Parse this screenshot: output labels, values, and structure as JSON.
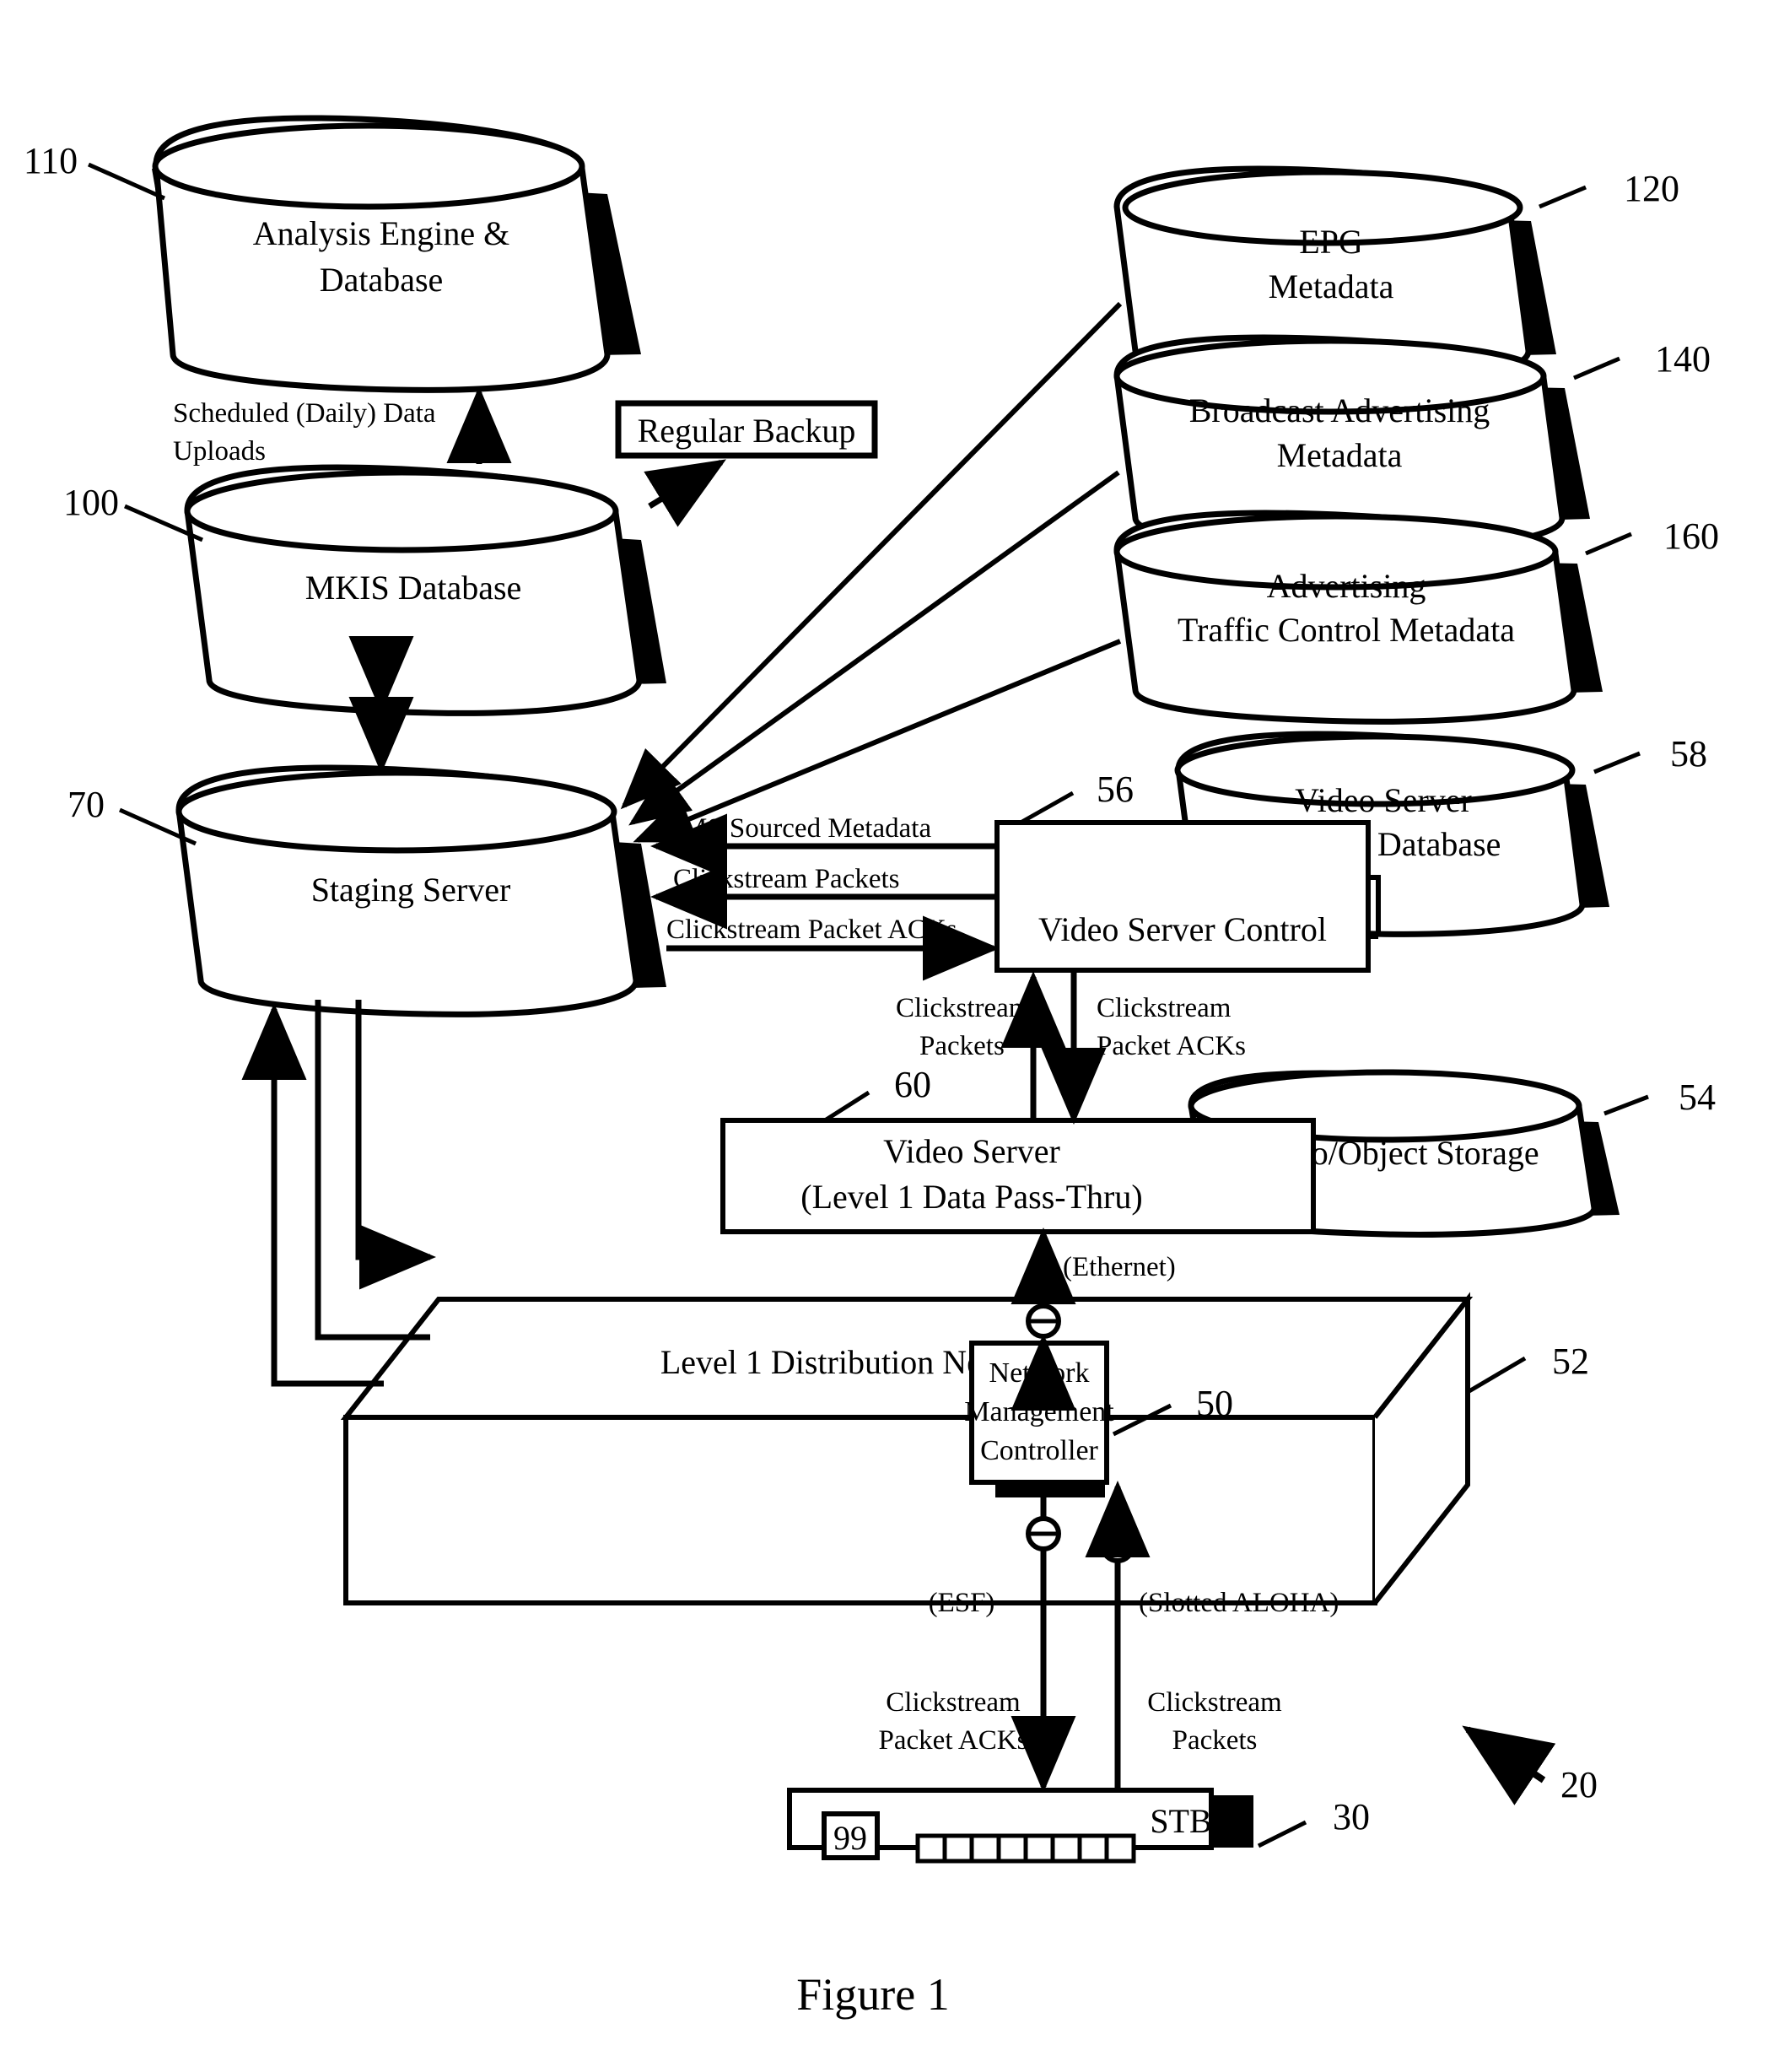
{
  "figure": {
    "caption": "Figure 1",
    "overall_ref": "20"
  },
  "nodes": {
    "analysis_engine": {
      "line1": "Analysis Engine &",
      "line2": "Database",
      "ref": "110",
      "shape": "cylinder"
    },
    "mkis_database": {
      "line1": "MKIS Database",
      "line2": "",
      "ref": "100",
      "shape": "cylinder"
    },
    "staging_server": {
      "line1": "Staging Server",
      "line2": "",
      "ref": "70",
      "shape": "cylinder"
    },
    "epg_metadata": {
      "line1": "EPG",
      "line2": "Metadata",
      "ref": "120",
      "shape": "cylinder"
    },
    "broadcast_ad_metadata": {
      "line1": "Broadcast Advertising",
      "line2": "Metadata",
      "ref": "140",
      "shape": "cylinder"
    },
    "ad_traffic_metadata": {
      "line1": "Advertising",
      "line2": "Traffic Control Metadata",
      "ref": "160",
      "shape": "cylinder"
    },
    "video_server_control_db": {
      "line1": "Video Server",
      "line2": "Control Database",
      "ref": "58",
      "shape": "cylinder"
    },
    "video_object_storage": {
      "line1": "Video/Object Storage",
      "line2": "",
      "ref": "54",
      "shape": "cylinder"
    },
    "regular_backup": {
      "line1": "Regular Backup",
      "line2": "",
      "ref": "",
      "shape": "box"
    },
    "video_server_control": {
      "line1": "Video Server Control",
      "line2": "",
      "ref": "56",
      "shape": "box"
    },
    "video_server": {
      "line1": "Video Server",
      "line2": "(Level 1 Data Pass-Thru)",
      "ref": "60",
      "shape": "box"
    },
    "distribution_network": {
      "line1": "Level 1 Distribution Network",
      "line2": "",
      "ref": "52",
      "shape": "box3d"
    },
    "network_mgmt_controller": {
      "line1": "Network",
      "line2": "Management",
      "line3": "Controller",
      "ref": "50",
      "shape": "box"
    },
    "stb": {
      "line1": "STB",
      "channel": "99",
      "ref": "30",
      "shape": "box"
    }
  },
  "flows": {
    "scheduled_uploads_l1": "Scheduled (Daily) Data",
    "scheduled_uploads_l2": "Uploads",
    "ims_sourced_metadata": "IMS Sourced Metadata",
    "clickstream_packets": "Clickstream Packets",
    "clickstream_packet_acks": "Clickstream Packet ACKs",
    "vs_packets_l1": "Clickstream",
    "vs_packets_l2": "Packets",
    "vs_acks_l1": "Clickstream",
    "vs_acks_l2": "Packet ACKs",
    "ethernet": "(Ethernet)",
    "esf": "(ESF)",
    "slotted_aloha": "(Slotted ALOHA)",
    "stb_acks_l1": "Clickstream",
    "stb_acks_l2": "Packet ACKs",
    "stb_packets_l1": "Clickstream",
    "stb_packets_l2": "Packets"
  },
  "colors": {
    "ink": "#000000",
    "paper": "#ffffff"
  }
}
